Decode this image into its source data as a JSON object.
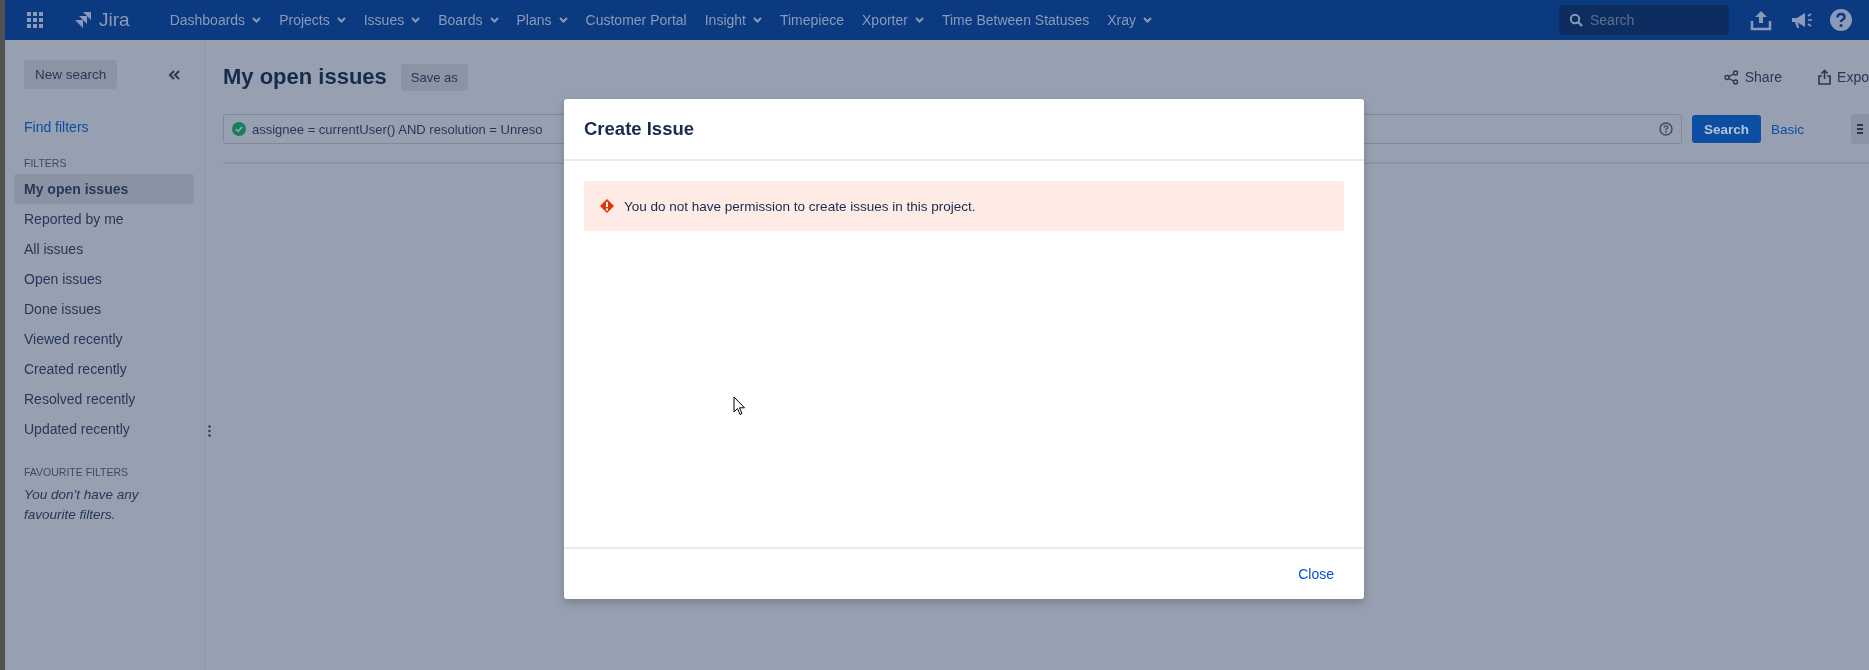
{
  "topbar": {
    "product": "Jira",
    "nav": [
      {
        "label": "Dashboards",
        "dropdown": true
      },
      {
        "label": "Projects",
        "dropdown": true
      },
      {
        "label": "Issues",
        "dropdown": true
      },
      {
        "label": "Boards",
        "dropdown": true
      },
      {
        "label": "Plans",
        "dropdown": true
      },
      {
        "label": "Customer Portal",
        "dropdown": false
      },
      {
        "label": "Insight",
        "dropdown": true
      },
      {
        "label": "Timepiece",
        "dropdown": false
      },
      {
        "label": "Xporter",
        "dropdown": true
      },
      {
        "label": "Time Between Statuses",
        "dropdown": false
      },
      {
        "label": "Xray",
        "dropdown": true
      }
    ],
    "search": {
      "placeholder": "Search"
    }
  },
  "sidebar": {
    "new_search": "New search",
    "find_filters": "Find filters",
    "filters_heading": "FILTERS",
    "items": [
      {
        "label": "My open issues",
        "selected": true
      },
      {
        "label": "Reported by me",
        "selected": false
      },
      {
        "label": "All issues",
        "selected": false
      },
      {
        "label": "Open issues",
        "selected": false
      },
      {
        "label": "Done issues",
        "selected": false
      },
      {
        "label": "Viewed recently",
        "selected": false
      },
      {
        "label": "Created recently",
        "selected": false
      },
      {
        "label": "Resolved recently",
        "selected": false
      },
      {
        "label": "Updated recently",
        "selected": false
      }
    ],
    "favourites_heading": "FAVOURITE FILTERS",
    "favourites_empty": "You don't have any favourite filters."
  },
  "header": {
    "title": "My open issues",
    "save_as": "Save as",
    "share": "Share",
    "export": "Expo"
  },
  "query": {
    "value": "assignee = currentUser() AND resolution = Unreso",
    "search_button": "Search",
    "mode_link": "Basic"
  },
  "dialog": {
    "title": "Create Issue",
    "error": "You do not have permission to create issues in this project.",
    "close": "Close"
  }
}
